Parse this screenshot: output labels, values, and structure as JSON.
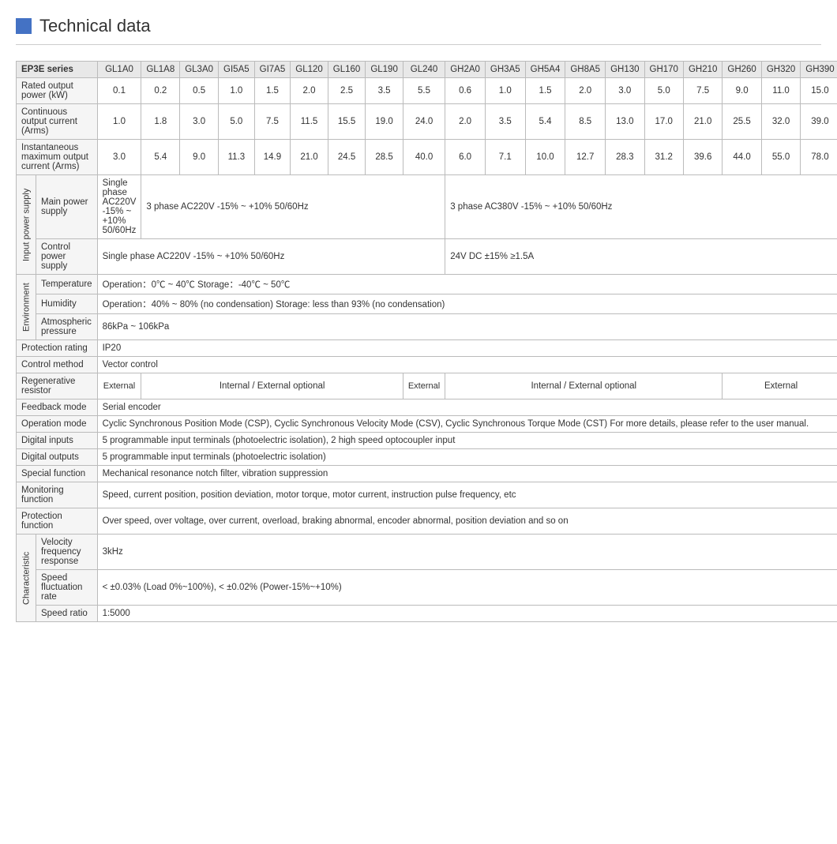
{
  "title": "Technical data",
  "series": {
    "label": "EP3E series",
    "columns": [
      "GL1A0",
      "GL1A8",
      "GL3A0",
      "GI5A5",
      "GI7A5",
      "GL120",
      "GL160",
      "GL190",
      "GL240",
      "GH2A0",
      "GH3A5",
      "GH5A4",
      "GH8A5",
      "GH130",
      "GH170",
      "GH210",
      "GH260",
      "GH320",
      "GH390"
    ]
  },
  "rows": {
    "rated_output_power_label": "Rated output power (kW)",
    "rated_output_power_values": [
      "0.1",
      "0.2",
      "0.5",
      "1.0",
      "1.5",
      "2.0",
      "2.5",
      "3.5",
      "5.5",
      "0.6",
      "1.0",
      "1.5",
      "2.0",
      "3.0",
      "5.0",
      "7.5",
      "9.0",
      "11.0",
      "15.0"
    ],
    "continuous_output_current_label": "Continuous output current (Arms)",
    "continuous_output_current_values": [
      "1.0",
      "1.8",
      "3.0",
      "5.0",
      "7.5",
      "11.5",
      "15.5",
      "19.0",
      "24.0",
      "2.0",
      "3.5",
      "5.4",
      "8.5",
      "13.0",
      "17.0",
      "21.0",
      "25.5",
      "32.0",
      "39.0"
    ],
    "instantaneous_max_current_label": "Instantaneous maximum output current (Arms)",
    "instantaneous_max_current_values": [
      "3.0",
      "5.4",
      "9.0",
      "11.3",
      "14.9",
      "21.0",
      "24.5",
      "28.5",
      "40.0",
      "6.0",
      "7.1",
      "10.0",
      "12.7",
      "28.3",
      "31.2",
      "39.6",
      "44.0",
      "55.0",
      "78.0"
    ]
  },
  "input_power_supply": {
    "group_label": "Input power supply",
    "main_power_supply_label": "Main power supply",
    "main_power_supply_values": [
      {
        "text": "Single phase AC220V -15% ~ +10% 50/60Hz",
        "cols": 1
      },
      {
        "text": "3 phase AC220V -15% ~ +10%  50/60Hz",
        "cols": 8
      },
      {
        "text": "3 phase AC380V -15% ~ +10%  50/60Hz",
        "cols": 10
      }
    ],
    "control_power_supply_label": "Control power supply",
    "control_power_supply_values": [
      {
        "text": "Single phase    AC220V   -15%  ~ +10%   50/60Hz",
        "cols": 9
      },
      {
        "text": "24V DC    ±15%   ≥1.5A",
        "cols": 10
      }
    ]
  },
  "environment": {
    "group_label": "Environment",
    "temperature_label": "Temperature",
    "temperature_value": "Operation：0℃ ~ 40℃            Storage：-40℃ ~ 50℃",
    "humidity_label": "Humidity",
    "humidity_value": "Operation：40%  ~ 80%  (no condensation)            Storage:  less than 93% (no condensation)",
    "atmospheric_pressure_label": "Atmospheric pressure",
    "atmospheric_pressure_value": "86kPa  ~ 106kPa"
  },
  "protection_rating_label": "Protection rating",
  "protection_rating_value": "IP20",
  "control_method_label": "Control method",
  "control_method_value": "Vector control",
  "regenerative_resistor_label": "Regenerative resistor",
  "regenerative_resistor_values": [
    {
      "text": "External",
      "cols": 1
    },
    {
      "text": "Internal / External optional",
      "cols": 7
    },
    {
      "text": "External",
      "cols": 1
    },
    {
      "text": "Internal / External optional",
      "cols": 7
    },
    {
      "text": "External",
      "cols": 3
    }
  ],
  "feedback_mode_label": "Feedback mode",
  "feedback_mode_value": "Serial encoder",
  "operation_mode_label": "Operation mode",
  "operation_mode_value": "Cyclic Synchronous Position Mode (CSP), Cyclic Synchronous Velocity Mode (CSV), Cyclic Synchronous Torque Mode (CST) For more details, please refer to  the user manual.",
  "digital_inputs_label": "Digital inputs",
  "digital_inputs_value": "5 programmable input terminals (photoelectric isolation), 2 high speed optocoupler input",
  "digital_outputs_label": "Digital outputs",
  "digital_outputs_value": "5 programmable input terminals (photoelectric isolation)",
  "special_function_label": "Special function",
  "special_function_value": "Mechanical resonance notch filter, vibration suppression",
  "monitoring_function_label": "Monitoring function",
  "monitoring_function_value": "Speed, current position, position deviation, motor torque, motor current, instruction pulse frequency, etc",
  "protection_function_label": "Protection function",
  "protection_function_value": "Over speed, over voltage, over current, overload, braking abnormal, encoder abnormal, position deviation and so on",
  "characteristic": {
    "group_label": "Characteristic",
    "velocity_frequency_response_label": "Velocity frequency response",
    "velocity_frequency_response_value": "3kHz",
    "speed_fluctuation_rate_label": "Speed fluctuation rate",
    "speed_fluctuation_rate_value": "< ±0.03% (Load 0%~100%),   < ±0.02% (Power-15%~+10%)",
    "speed_ratio_label": "Speed ratio",
    "speed_ratio_value": "1:5000"
  }
}
